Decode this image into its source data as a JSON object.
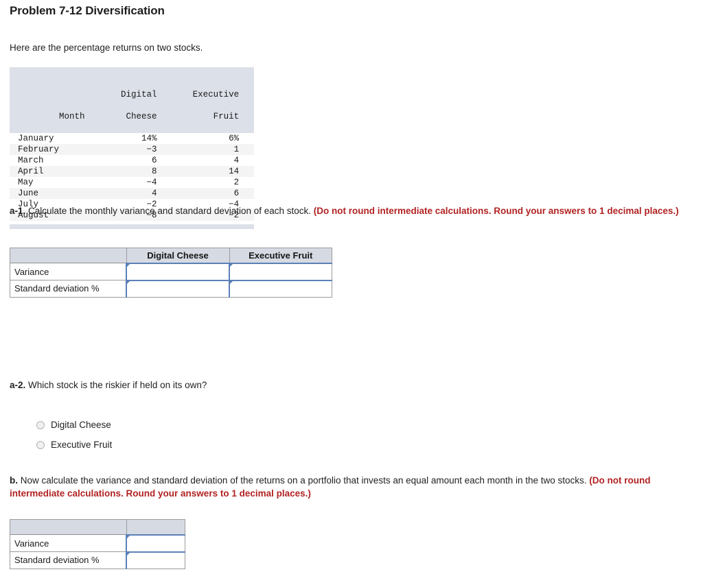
{
  "page": {
    "title": "Problem 7-12 Diversification",
    "intro": "Here are the percentage returns on two stocks."
  },
  "exhibit": {
    "headers": {
      "month": "Month",
      "stock1_line1": "Digital",
      "stock1_line2": "Cheese",
      "stock2_line1": "Executive",
      "stock2_line2": "Fruit"
    },
    "rows": [
      {
        "month": "January",
        "digital_cheese": "14%",
        "executive_fruit": "6%"
      },
      {
        "month": "February",
        "digital_cheese": "−3",
        "executive_fruit": "1"
      },
      {
        "month": "March",
        "digital_cheese": "6",
        "executive_fruit": "4"
      },
      {
        "month": "April",
        "digital_cheese": "8",
        "executive_fruit": "14"
      },
      {
        "month": "May",
        "digital_cheese": "−4",
        "executive_fruit": "2"
      },
      {
        "month": "June",
        "digital_cheese": "4",
        "executive_fruit": "6"
      },
      {
        "month": "July",
        "digital_cheese": "−2",
        "executive_fruit": "−4"
      },
      {
        "month": "August",
        "digital_cheese": "−8",
        "executive_fruit": "−2"
      }
    ]
  },
  "questions": {
    "a1": {
      "label": "a-1.",
      "text": " Calculate the monthly variance and standard deviation of each stock. ",
      "note": "(Do not round intermediate calculations. Round your answers to 1 decimal places.)"
    },
    "a2": {
      "label": "a-2.",
      "text": " Which stock is the riskier if held on its own?"
    },
    "b": {
      "label": "b.",
      "text": " Now calculate the variance and standard deviation of the  returns on a portfolio that invests an equal amount each month in the two stocks. ",
      "note": "(Do not round intermediate calculations. Round your answers to 1 decimal places.)"
    }
  },
  "answer_table_a1": {
    "corner_label": "",
    "columns": [
      "Digital Cheese",
      "Executive Fruit"
    ],
    "rows": [
      {
        "label": "Variance",
        "digital_cheese": "",
        "executive_fruit": ""
      },
      {
        "label": "Standard deviation %",
        "digital_cheese": "",
        "executive_fruit": ""
      }
    ]
  },
  "answer_table_b": {
    "corner_label": "",
    "columns": [
      ""
    ],
    "rows": [
      {
        "label": "Variance",
        "value": ""
      },
      {
        "label": "Standard deviation %",
        "value": ""
      }
    ]
  },
  "radio_options": [
    {
      "label": "Digital Cheese",
      "selected": false
    },
    {
      "label": "Executive Fruit",
      "selected": false
    }
  ],
  "colors": {
    "header_fill": "#d6dae3",
    "exhibit_header_fill": "#dce0e9",
    "input_border": "#5b80b7",
    "note_red": "#b22222",
    "row_stripe": "#f4f4f4"
  }
}
